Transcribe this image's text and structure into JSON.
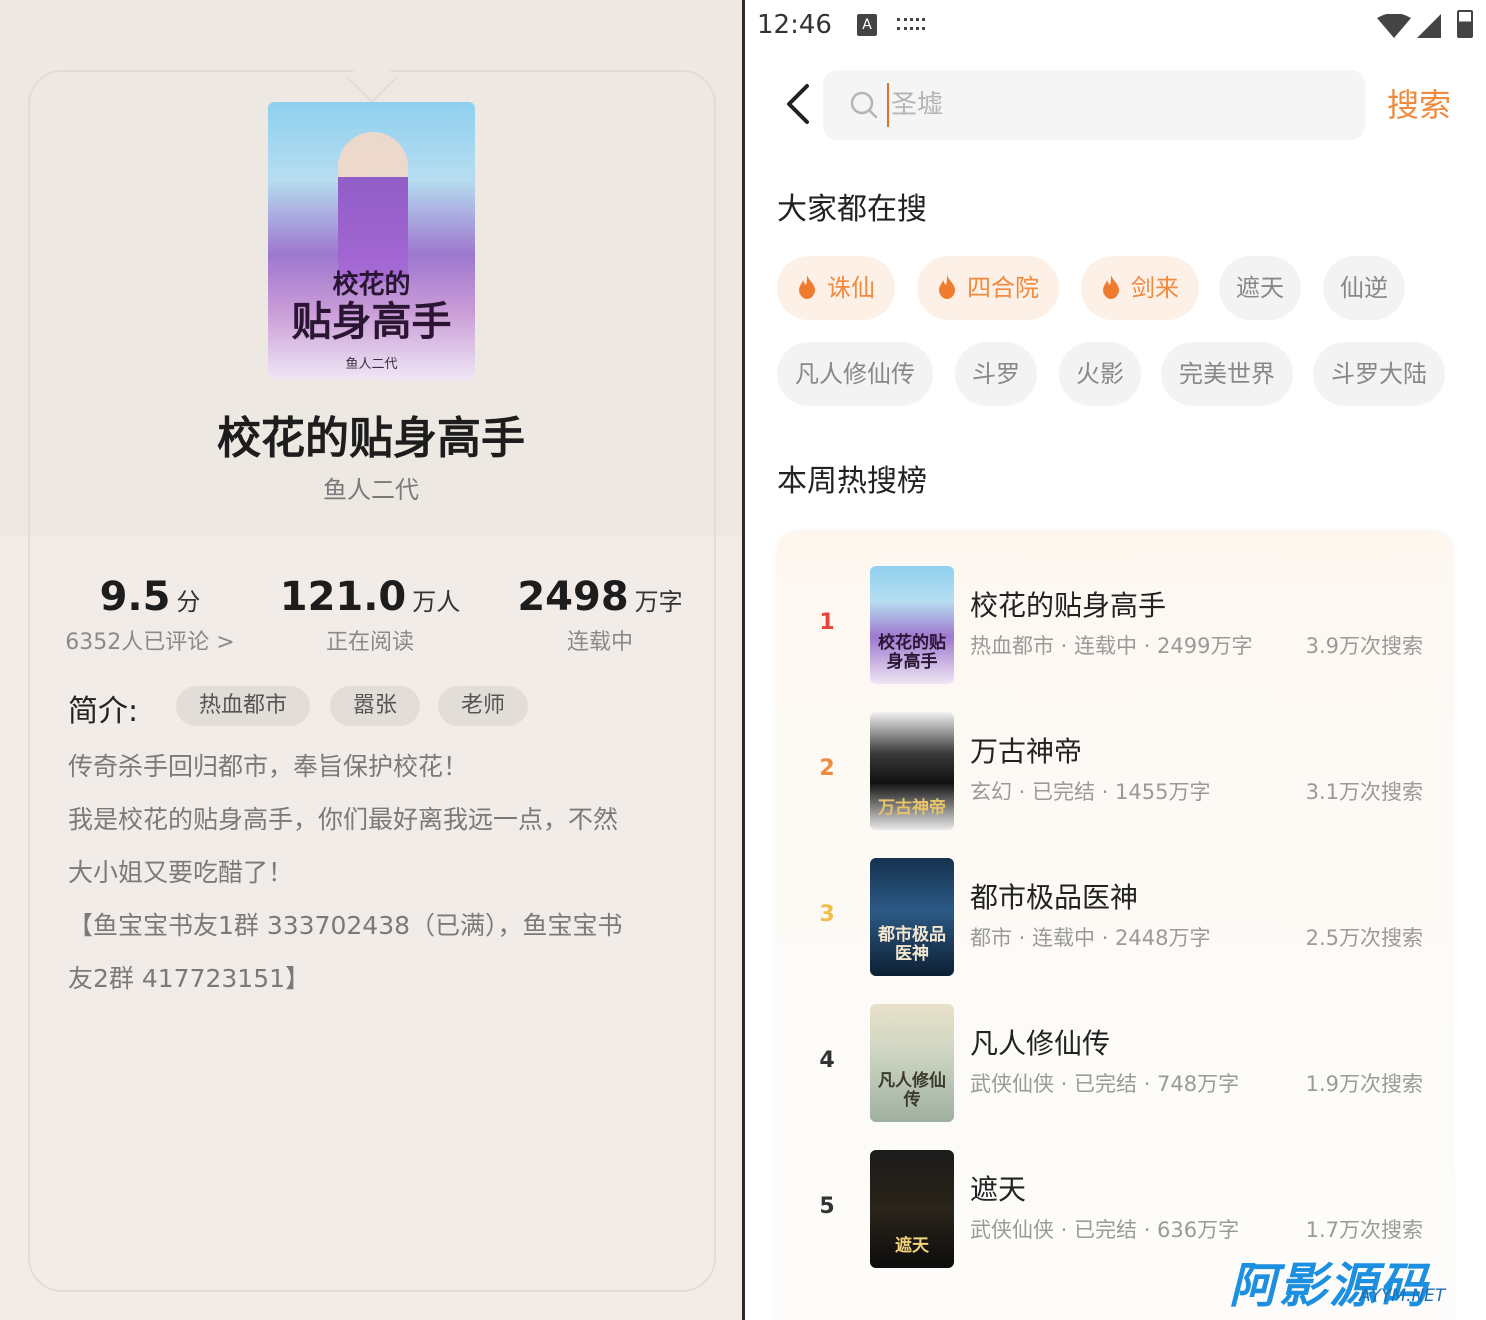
{
  "detail": {
    "title": "校花的贴身高手",
    "author": "鱼人二代",
    "cover": {
      "title_small": "校花的",
      "title_big": "贴身高手",
      "author": "鱼人二代"
    },
    "stats": {
      "rating_value": "9.5",
      "rating_unit": "分",
      "rating_sub": "6352人已评论 >",
      "reading_value": "121.0",
      "reading_unit": "万人",
      "reading_sub": "正在阅读",
      "words_value": "2498",
      "words_unit": "万字",
      "words_sub": "连载中"
    },
    "intro_label": "简介:",
    "tags": [
      "热血都市",
      "嚣张",
      "老师"
    ],
    "intro_lines": [
      "传奇杀手回归都市，奉旨保护校花！",
      "我是校花的贴身高手，你们最好离我远一点，不然",
      "大小姐又要吃醋了！",
      "【鱼宝宝书友1群 333702438（已满），鱼宝宝书",
      "友2群 417723151】"
    ]
  },
  "status_bar": {
    "time": "12:46",
    "a_icon": "A"
  },
  "search": {
    "placeholder": "圣墟",
    "button": "搜索"
  },
  "hot_searches": {
    "title": "大家都在搜",
    "chips": [
      {
        "label": "诛仙",
        "hot": true
      },
      {
        "label": "四合院",
        "hot": true
      },
      {
        "label": "剑来",
        "hot": true
      },
      {
        "label": "遮天",
        "hot": false
      },
      {
        "label": "仙逆",
        "hot": false
      },
      {
        "label": "凡人修仙传",
        "hot": false
      },
      {
        "label": "斗罗",
        "hot": false
      },
      {
        "label": "火影",
        "hot": false
      },
      {
        "label": "完美世界",
        "hot": false
      },
      {
        "label": "斗罗大陆",
        "hot": false
      }
    ]
  },
  "weekly": {
    "title": "本周热搜榜",
    "items": [
      {
        "rank": "1",
        "name": "校花的贴身高手",
        "meta": "热血都市 · 连载中 · 2499万字",
        "count": "3.9万次搜索",
        "rank_color": "#e8443a",
        "cover_text": "校花的贴身高手"
      },
      {
        "rank": "2",
        "name": "万古神帝",
        "meta": "玄幻 · 已完结 · 1455万字",
        "count": "3.1万次搜索",
        "rank_color": "#f08a3e",
        "cover_text": "万古神帝"
      },
      {
        "rank": "3",
        "name": "都市极品医神",
        "meta": "都市 · 连载中 · 2448万字",
        "count": "2.5万次搜索",
        "rank_color": "#f2bd4a",
        "cover_text": "都市极品医神"
      },
      {
        "rank": "4",
        "name": "凡人修仙传",
        "meta": "武侠仙侠 · 已完结 · 748万字",
        "count": "1.9万次搜索",
        "rank_color": "#333333",
        "cover_text": "凡人修仙传"
      },
      {
        "rank": "5",
        "name": "遮天",
        "meta": "武侠仙侠 · 已完结 · 636万字",
        "count": "1.7万次搜索",
        "rank_color": "#333333",
        "cover_text": "遮天"
      }
    ]
  },
  "watermark": {
    "text": "阿影源码",
    "sub": "AYYM.NET"
  },
  "colors": {
    "accent": "#f08a3e",
    "rank1": "#e8443a",
    "rank2": "#f08a3e",
    "rank3": "#f2bd4a"
  }
}
